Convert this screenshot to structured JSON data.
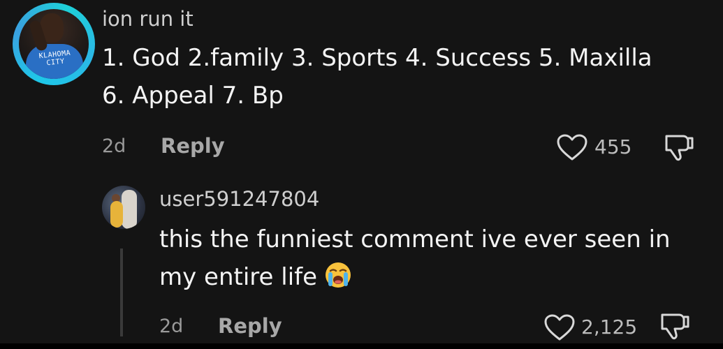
{
  "comment": {
    "username": "ion run it",
    "text_line1": "1. God 2.family 3. Sports 4. Success 5. Maxilla",
    "text_line2": "6. Appeal 7. Bp",
    "time": "2d",
    "reply_label": "Reply",
    "likes": "455",
    "avatar_jersey_line1": "KLAHOMA",
    "avatar_jersey_line2": "CITY",
    "icons": {
      "like": "heart-outline-icon",
      "dislike": "thumbs-down-outline-icon"
    }
  },
  "reply": {
    "username": "user591247804",
    "text_line1": "this the funniest comment ive ever seen in",
    "text_line2": "my entire life",
    "emoji": "loudly-crying-face-emoji",
    "time": "2d",
    "reply_label": "Reply",
    "likes": "2,125",
    "icons": {
      "like": "heart-outline-icon",
      "dislike": "thumbs-down-outline-icon"
    }
  },
  "colors": {
    "background": "#141414",
    "avatar_ring": "#1ec8e8",
    "primary_text": "#f4f4f4",
    "secondary_text": "#9a9a9a"
  }
}
